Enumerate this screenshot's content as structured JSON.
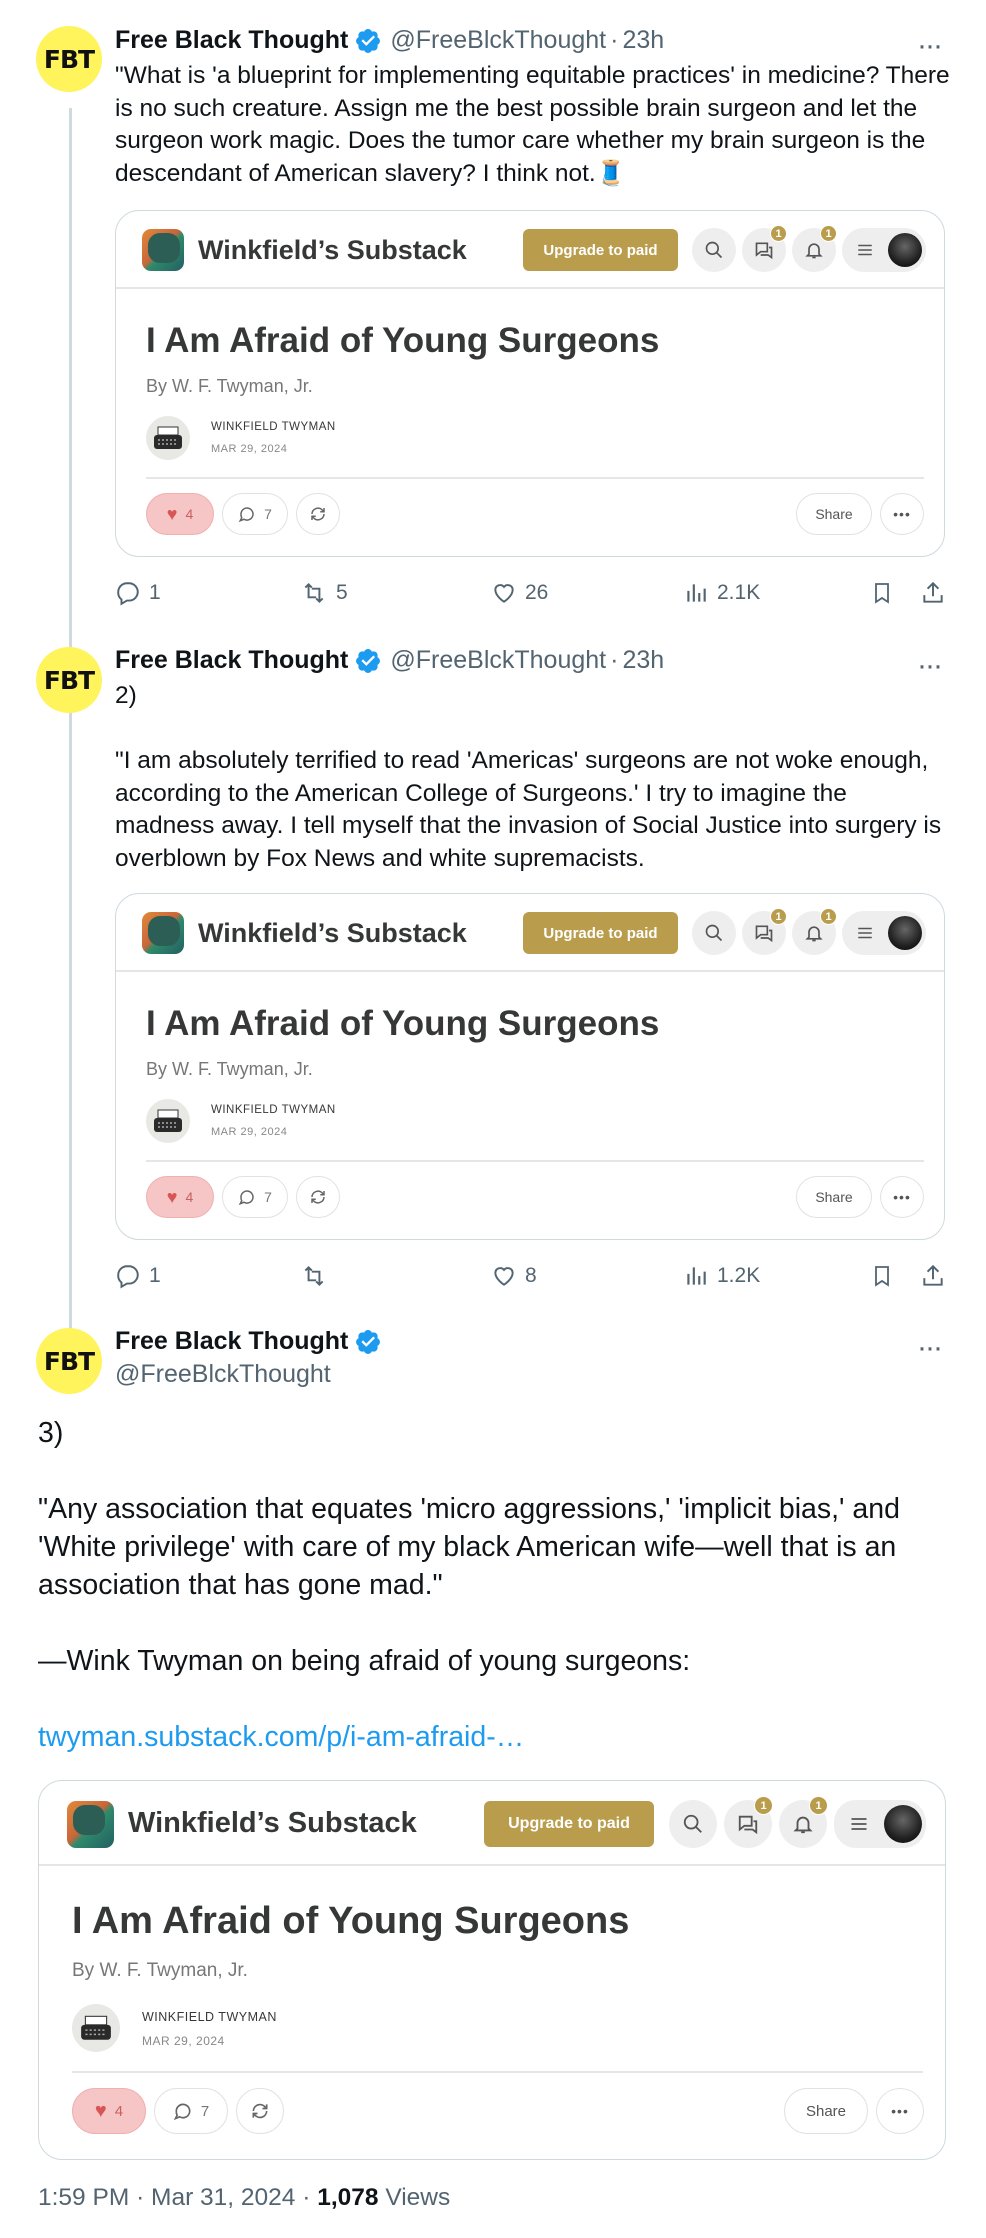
{
  "author": {
    "name": "Free Black Thought",
    "handle": "@FreeBlckThought",
    "avatar_text": "FBT",
    "avatar_color": "#fff45c",
    "verified_color": "#1d9bf0"
  },
  "tweets": [
    {
      "time": "23h",
      "text": "\"What is 'a blueprint for implementing equitable practices' in medicine? There is no such creature. Assign me the best possible brain surgeon and let the surgeon work magic. Does the tumor care whether my brain surgeon is the descendant of American slavery? I think not.🧵",
      "stats": {
        "replies": "1",
        "reposts": "5",
        "likes": "26",
        "views": "2.1K"
      }
    },
    {
      "time": "23h",
      "text": "2)\n\n\"I am absolutely terrified to read 'Americas' surgeons are not woke enough, according to the American College of Surgeons.' I try to imagine the madness away. I tell myself that the invasion of Social Justice into surgery is overblown by Fox News and white supremacists.",
      "stats": {
        "replies": "1",
        "reposts": "",
        "likes": "8",
        "views": "1.2K"
      }
    },
    {
      "text_main": "3)\n\n\"Any association that equates 'micro aggressions,' 'implicit bias,' and 'White privilege' with care of my black American wife—well that is an association that has gone mad.\"\n\n—Wink Twyman on being afraid of young surgeons:\n\n",
      "link": "twyman.substack.com/p/i-am-afraid-…"
    }
  ],
  "card": {
    "site_name": "Winkfield’s Substack",
    "upgrade_label": "Upgrade to paid",
    "chat_badge": "1",
    "bell_badge": "1",
    "title": "I Am Afraid of Young Surgeons",
    "byline": "By W. F. Twyman, Jr.",
    "author_name": "WINKFIELD TWYMAN",
    "date": "MAR 29, 2024",
    "likes": "4",
    "comments": "7",
    "share_label": "Share",
    "accent": "#b99d4c"
  },
  "footer": {
    "time": "1:59 PM",
    "date": "Mar 31, 2024",
    "views_count": "1,078",
    "views_label": "Views"
  }
}
